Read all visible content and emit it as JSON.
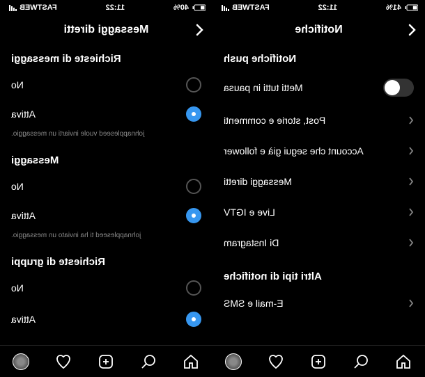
{
  "status": {
    "time": "11:22",
    "carrier": "FASTWEB",
    "battery_left": "40%",
    "battery_right": "41%"
  },
  "left_screen": {
    "header_title": "Messaggi diretti",
    "sections": {
      "richieste_header": "Richieste di messaggi",
      "no_label": "No",
      "attiva_label": "Attiva",
      "hint1": "johnappleseed vuole inviarti un messaggio.",
      "messaggi_header": "Messaggi",
      "hint2": "johnappleseed ti ha inviato un messaggio.",
      "gruppi_header": "Richieste di gruppi"
    }
  },
  "right_screen": {
    "header_title": "Notifiche",
    "push_header": "Notifiche push",
    "pause_label": "Metti tutti in pausa",
    "items": {
      "post": "Post, storie e commenti",
      "account": "Account che segui già e follower",
      "messaggi": "Messaggi diretti",
      "live": "Live e IGTV",
      "di_instagram": "Di Instagram"
    },
    "altri_header": "Altri tipi di notifiche",
    "email_sms": "E-mail e SMS"
  }
}
